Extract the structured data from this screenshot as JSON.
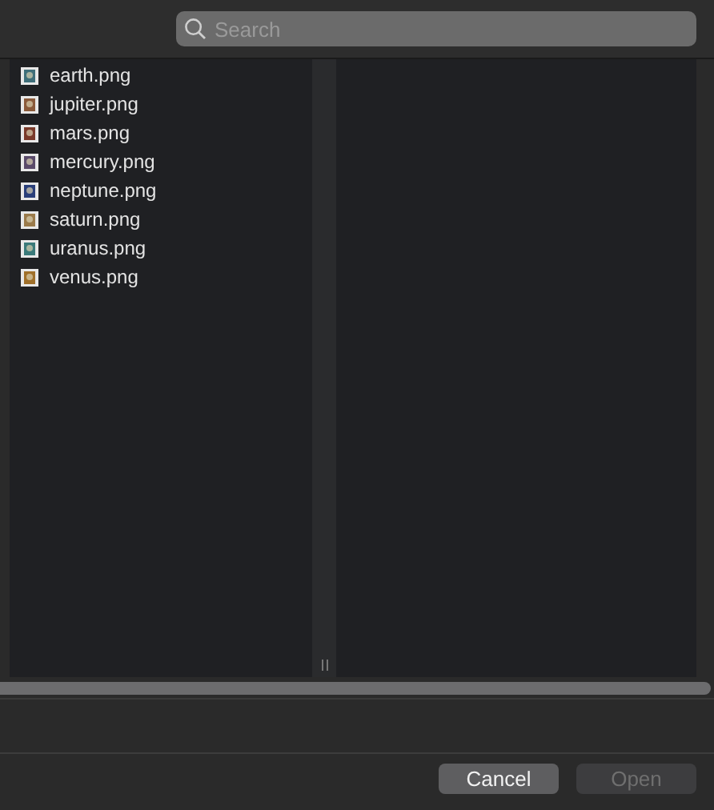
{
  "search": {
    "placeholder": "Search"
  },
  "files": [
    {
      "name": "earth.png",
      "color": "#3f6f7a"
    },
    {
      "name": "jupiter.png",
      "color": "#8a5a3a"
    },
    {
      "name": "mars.png",
      "color": "#7a3a2a"
    },
    {
      "name": "mercury.png",
      "color": "#5a4a6a"
    },
    {
      "name": "neptune.png",
      "color": "#2a3f7a"
    },
    {
      "name": "saturn.png",
      "color": "#9a7a4a"
    },
    {
      "name": "uranus.png",
      "color": "#3a7a7a"
    },
    {
      "name": "venus.png",
      "color": "#a0702a"
    }
  ],
  "buttons": [
    {
      "label": "Cancel",
      "disabled": false
    },
    {
      "label": "Open",
      "disabled": true
    }
  ]
}
